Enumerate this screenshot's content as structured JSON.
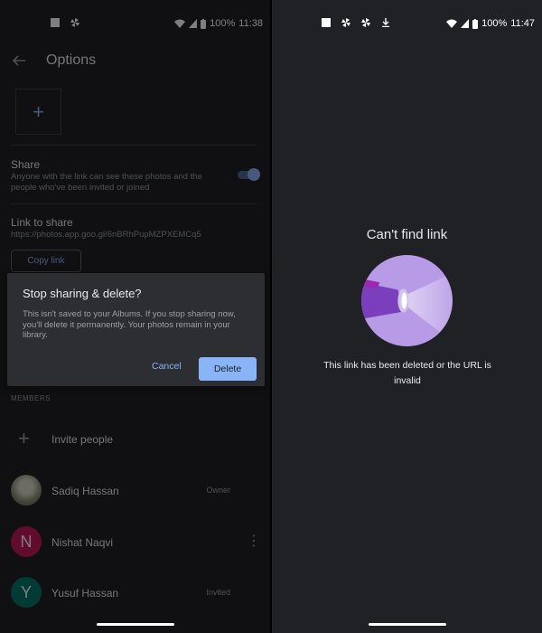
{
  "left": {
    "status": {
      "battery": "100%",
      "time": "11:38"
    },
    "appbar": {
      "title": "Options"
    },
    "share": {
      "label": "Share",
      "description": "Anyone with the link can see these photos and the people who've been invited or joined",
      "enabled": true
    },
    "link": {
      "label": "Link to share",
      "url": "https://photos.app.goo.gl/6nBRhPupMZPXEMCq5",
      "copy_label": "Copy link"
    },
    "members": {
      "heading": "MEMBERS",
      "invite_label": "Invite people",
      "list": [
        {
          "name": "Sadiq Hassan",
          "role": "Owner",
          "initial": "",
          "color": "#8a8f74"
        },
        {
          "name": "Nishat Naqvi",
          "role": "",
          "initial": "N",
          "color": "#c2185b"
        },
        {
          "name": "Yusuf Hassan",
          "role": "Invited",
          "initial": "Y",
          "color": "#00796b"
        }
      ]
    },
    "dialog": {
      "title": "Stop sharing & delete?",
      "body": "This isn't saved to your Albums. If you stop sharing now, you'll delete it permanently. Your photos remain in your library.",
      "cancel": "Cancel",
      "delete": "Delete"
    }
  },
  "right": {
    "status": {
      "battery": "100%",
      "time": "11:47"
    },
    "title": "Can't find link",
    "message": "This link has been deleted or the URL is invalid"
  },
  "colors": {
    "background": "#202124",
    "accent": "#8ab4f8",
    "illustration": "#b79be6"
  }
}
